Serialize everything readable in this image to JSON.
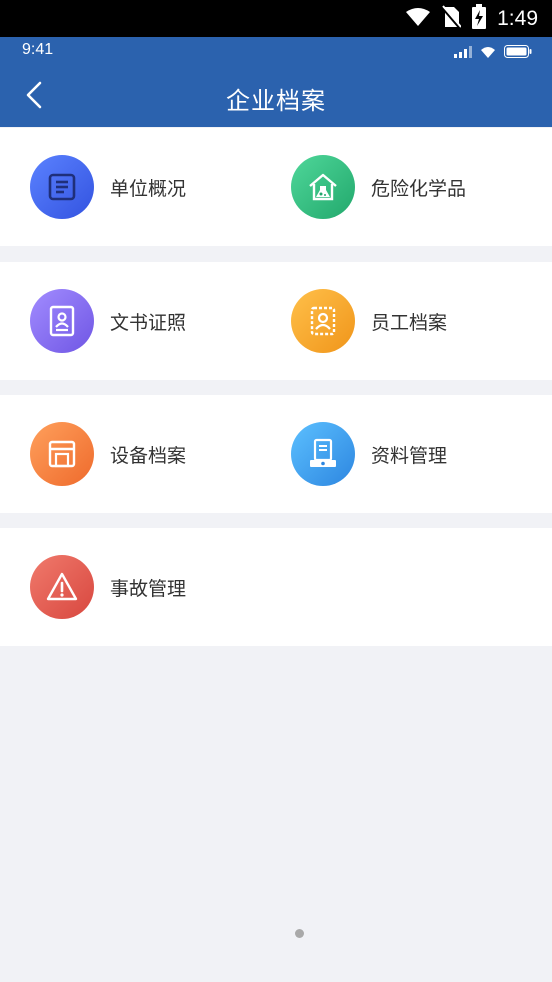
{
  "android_status": {
    "time": "1:49"
  },
  "ios_status": {
    "time": "9:41"
  },
  "header": {
    "title": "企业档案"
  },
  "colors": {
    "header_bg": "#2b62ae",
    "page_bg": "#f1f2f6",
    "unit_overview": "#3f6cf0",
    "hazardous_chemicals": "#2fbf83",
    "documents": "#8a72f2",
    "employee_files": "#f5a62d",
    "equipment_files": "#f57d3f",
    "material_management": "#3a9cf0",
    "accident_management": "#e05a55"
  },
  "menu": [
    {
      "id": "unit_overview",
      "label": "单位概况",
      "icon": "document-list-icon"
    },
    {
      "id": "hazardous_chemicals",
      "label": "危险化学品",
      "icon": "flask-house-icon"
    },
    {
      "id": "documents",
      "label": "文书证照",
      "icon": "id-card-icon"
    },
    {
      "id": "employee_files",
      "label": "员工档案",
      "icon": "person-badge-icon"
    },
    {
      "id": "equipment_files",
      "label": "设备档案",
      "icon": "equipment-cabinet-icon"
    },
    {
      "id": "material_management",
      "label": "资料管理",
      "icon": "file-tray-icon"
    },
    {
      "id": "accident_management",
      "label": "事故管理",
      "icon": "warning-triangle-icon"
    }
  ]
}
